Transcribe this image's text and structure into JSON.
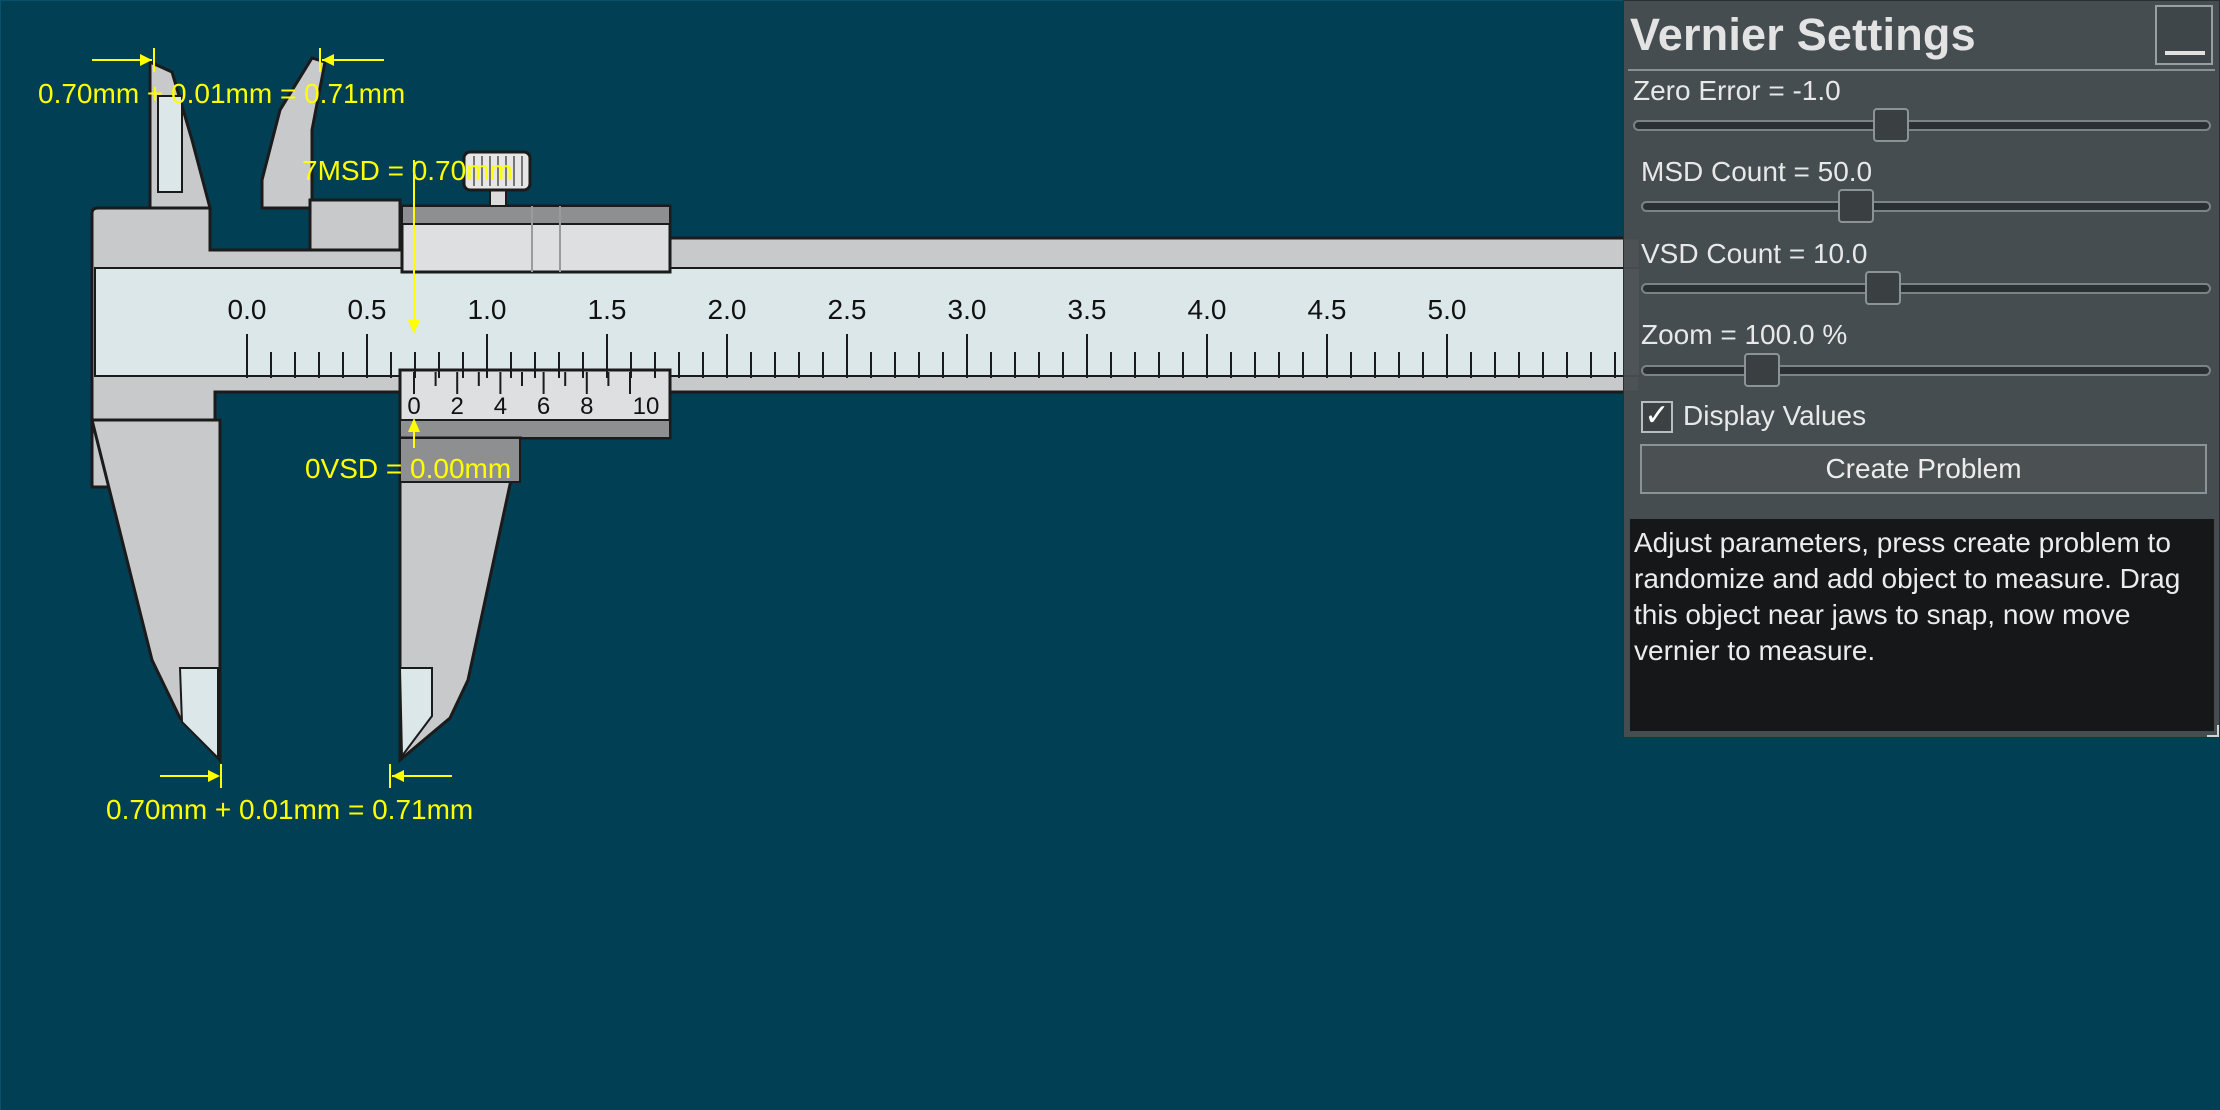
{
  "caliper": {
    "main_scale_labels": [
      "0.0",
      "0.5",
      "1.0",
      "1.5",
      "2.0",
      "2.5",
      "3.0",
      "3.5",
      "4.0",
      "4.5",
      "5.0"
    ],
    "vernier_scale_labels": [
      "0",
      "2",
      "4",
      "6",
      "8",
      "10"
    ],
    "top_jaw_reading": "0.70mm + 0.01mm = 0.71mm",
    "bottom_jaw_reading": "0.70mm + 0.01mm = 0.71mm",
    "msd_annotation": "7MSD = 0.70mm",
    "vsd_annotation": "0VSD = 0.00mm",
    "annotation_color": "#ffff00"
  },
  "panel": {
    "title": "Vernier Settings",
    "minimize_icon": "minimize-icon",
    "sliders": [
      {
        "label": "Zero Error = -1.0",
        "value": -1.0
      },
      {
        "label": "MSD Count = 50.0",
        "value": 50.0
      },
      {
        "label": "VSD Count = 10.0",
        "value": 10.0
      },
      {
        "label": "Zoom = 100.0 %",
        "value": 100.0
      }
    ],
    "display_values_label": "Display Values",
    "display_values_checked": true,
    "checkmark_icon": "✓",
    "create_button_label": "Create Problem",
    "info_text": "Adjust parameters, press create problem to randomize and add object to measure. Drag this object near jaws to snap, now move vernier to measure."
  },
  "colors": {
    "background": "#013f55",
    "caliper_body": "#c9cacb",
    "scale_face": "#dbe6e8",
    "panel": "#484e50"
  }
}
